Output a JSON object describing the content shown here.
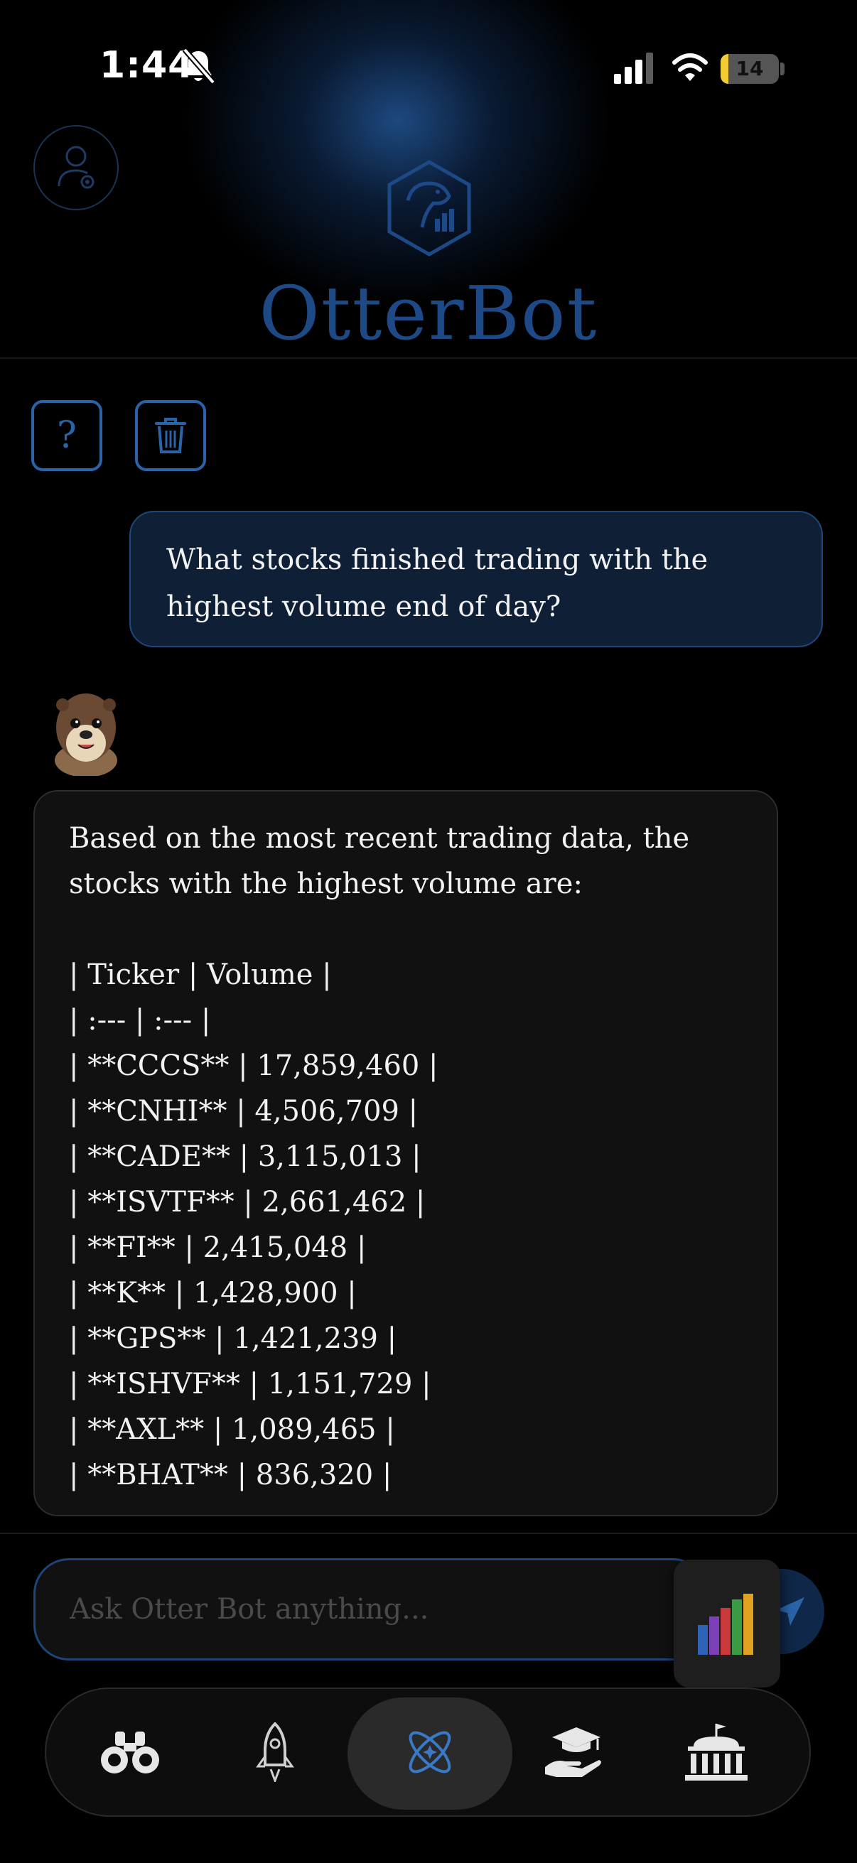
{
  "status_bar": {
    "time": "1:44",
    "battery_level": "14",
    "battery_fraction": 0.14,
    "bell_icon": "bell-slash-icon",
    "signal_icon": "cellular-signal-icon",
    "wifi_icon": "wifi-icon"
  },
  "header": {
    "brand": "OtterBot",
    "profile_icon": "user-settings-icon",
    "logo_icon": "otter-hexagon-logo-icon"
  },
  "actions": {
    "help_label": "?",
    "trash_icon": "trash-icon"
  },
  "chat": {
    "user_message": "What stocks finished trading with the highest volume end of day?",
    "bot_intro": "Based on the most recent trading data, the stocks with the highest volume are:",
    "bot_table_lines": [
      "| Ticker | Volume |",
      "| :--- | :--- |",
      "| **CCCS** | 17,859,460 |",
      "| **CNHI** | 4,506,709 |",
      "| **CADE** | 3,115,013 |",
      "| **ISVTF** | 2,661,462 |",
      "| **FI** | 2,415,048 |",
      "| **K** | 1,428,900 |",
      "| **GPS** | 1,421,239 |",
      "| **ISHVF** | 1,151,729 |",
      "| **AXL** | 1,089,465 |",
      "| **BHAT** | 836,320 |"
    ]
  },
  "composer": {
    "placeholder": "Ask Otter Bot anything...",
    "send_icon": "paper-plane-icon",
    "chart_icon": "bar-chart-icon"
  },
  "nav": {
    "items": [
      {
        "icon": "binoculars-icon",
        "active": false
      },
      {
        "icon": "rocket-icon",
        "active": false
      },
      {
        "icon": "atom-icon",
        "active": true
      },
      {
        "icon": "graduation-hand-icon",
        "active": false
      },
      {
        "icon": "government-building-icon",
        "active": false
      }
    ]
  },
  "colors": {
    "accent": "#2a64a8",
    "brand_text": "#1d4a86",
    "user_bubble": "#0f1f36",
    "bot_bubble": "#111111",
    "battery": "#f1cc35"
  }
}
